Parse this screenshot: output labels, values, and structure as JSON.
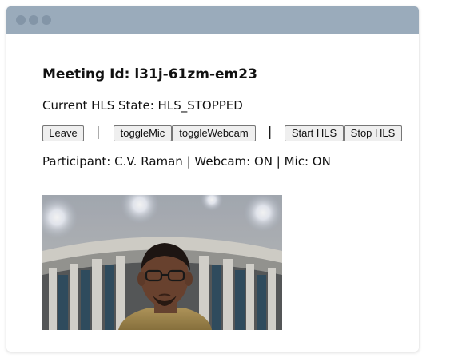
{
  "meeting": {
    "label": "Meeting Id: l31j-61zm-em23"
  },
  "hls": {
    "state_text": "Current HLS State: HLS_STOPPED"
  },
  "controls": {
    "leave": "Leave",
    "separator_1": "|",
    "toggle_mic": "toggleMic",
    "toggle_webcam": "toggleWebcam",
    "separator_2": "|",
    "start_hls": "Start HLS",
    "stop_hls": "Stop HLS"
  },
  "participant": {
    "info": "Participant: C.V. Raman | Webcam: ON | Mic: ON"
  },
  "colors": {
    "titlebar": "#9aabbb",
    "window_dots": "#8395a7"
  }
}
